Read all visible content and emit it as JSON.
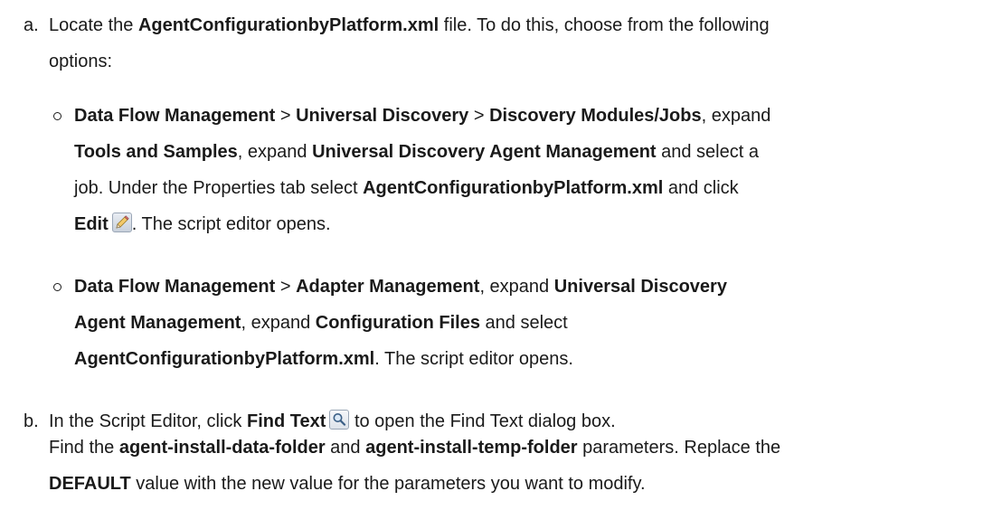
{
  "step_a": {
    "marker": "a.",
    "line1": {
      "t1": "Locate the ",
      "b1": "AgentConfigurationbyPlatform.xml",
      "t2": " file. To do this, choose from the following"
    },
    "line2": "options:",
    "option1": {
      "line1": {
        "b1": "Data Flow Management",
        "t1": " > ",
        "b2": "Universal Discovery",
        "t2": " > ",
        "b3": "Discovery Modules/Jobs",
        "t3": ", expand"
      },
      "line2": {
        "b1": "Tools and Samples",
        "t1": ", expand ",
        "b2": "Universal Discovery Agent Management",
        "t2": " and select a"
      },
      "line3": {
        "t1": "job. Under the Properties tab select ",
        "b1": "AgentConfigurationbyPlatform.xml",
        "t2": " and click"
      },
      "line4": {
        "b1": "Edit",
        "icon": "edit-pencil-icon",
        "t1": ". The script editor opens."
      }
    },
    "option2": {
      "line1": {
        "b1": "Data Flow Management",
        "t1": " > ",
        "b2": "Adapter Management",
        "t2": ", expand ",
        "b3": "Universal Discovery"
      },
      "line2": {
        "b1": "Agent Management",
        "t1": ", expand ",
        "b2": "Configuration Files",
        "t2": " and select"
      },
      "line3": {
        "b1": "AgentConfigurationbyPlatform.xml",
        "t1": ". The script editor opens."
      }
    }
  },
  "step_b": {
    "marker": "b.",
    "line1": {
      "t1": "In the Script Editor, click ",
      "b1": "Find Text",
      "icon": "find-text-magnifier-icon",
      "t2": " to open the Find Text dialog box."
    },
    "line2": {
      "t1": "Find the ",
      "b1": "agent-install-data-folder",
      "t2": " and ",
      "b2": "agent-install-temp-folder",
      "t3": " parameters. Replace the"
    },
    "line3": {
      "b1": "DEFAULT",
      "t1": " value with the new value for the parameters you want to modify."
    }
  }
}
